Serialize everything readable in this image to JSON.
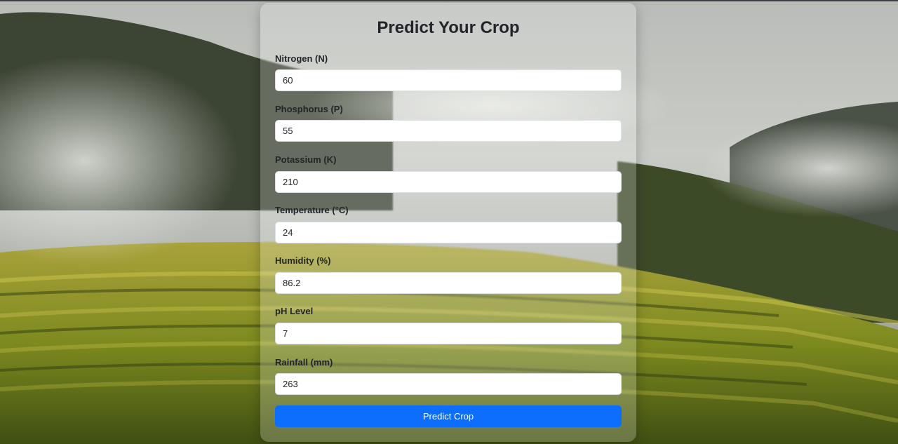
{
  "page": {
    "title": "Predict Your Crop"
  },
  "fields": [
    {
      "label": "Nitrogen (N)",
      "value": "60"
    },
    {
      "label": "Phosphorus (P)",
      "value": "55"
    },
    {
      "label": "Potassium (K)",
      "value": "210"
    },
    {
      "label": "Temperature (°C)",
      "value": "24"
    },
    {
      "label": "Humidity (%)",
      "value": "86.2"
    },
    {
      "label": "pH Level",
      "value": "7"
    },
    {
      "label": "Rainfall (mm)",
      "value": "263"
    }
  ],
  "submit_label": "Predict Crop",
  "colors": {
    "primary_button": "#0d6efd",
    "text": "#212529"
  }
}
